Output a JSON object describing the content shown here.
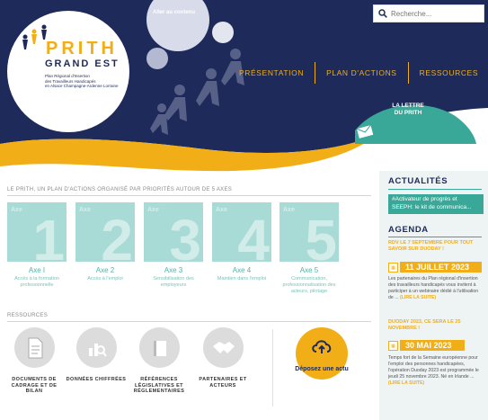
{
  "header": {
    "skip_link": "Aller au contenu",
    "search_placeholder": "Recherche...",
    "nav": [
      "PRÉSENTATION",
      "PLAN D'ACTIONS",
      "RESSOURCES"
    ],
    "lettre_line1": "LA LETTRE",
    "lettre_line2": "DU PRITH"
  },
  "logo": {
    "title": "PRITH",
    "subtitle": "GRAND EST",
    "tagline_1": "Plan Régional d'Insertion",
    "tagline_2": "des Travailleurs Handicapés",
    "tagline_3": "en Alsace Champagne-Ardenne Lorraine"
  },
  "plan": {
    "title": "LE PRITH, UN PLAN D'ACTIONS ORGANISÉ PAR PRIORITÉS AUTOUR DE 5 AXES",
    "axes": [
      {
        "tile": "Axe",
        "num": "1",
        "name": "Axe I",
        "desc": "Accès à la formation professionnelle"
      },
      {
        "tile": "Axe",
        "num": "2",
        "name": "Axe 2",
        "desc": "Accès à l'emploi"
      },
      {
        "tile": "Axe",
        "num": "3",
        "name": "Axe 3",
        "desc": "Sensibilisation des employeurs"
      },
      {
        "tile": "Axe",
        "num": "4",
        "name": "Axe 4",
        "desc": "Maintien dans l'emploi"
      },
      {
        "tile": "Axe",
        "num": "5",
        "name": "Axe 5",
        "desc": "Communication, professionnalisation des acteurs, pilotage"
      }
    ]
  },
  "resources": {
    "title": "RESSOURCES",
    "items": [
      {
        "icon": "document-icon",
        "label": "DOCUMENTS DE CADRAGE ET DE BILAN"
      },
      {
        "icon": "chart-search-icon",
        "label": "DONNÉES CHIFFRÉES"
      },
      {
        "icon": "book-icon",
        "label": "RÉFÉRENCES LÉGISLATIVES ET RÉGLEMENTAIRES"
      },
      {
        "icon": "handshake-icon",
        "label": "PARTENAIRES ET ACTEURS"
      }
    ],
    "deposez": "Déposez une actu"
  },
  "sidebar": {
    "actualites_title": "ACTUALITÉS",
    "actualites_item": "#Activateur de progrès et SEEPH: le kit de communica...",
    "agenda_title": "AGENDA",
    "events": [
      {
        "title": "RDV LE 7 SEPTEMBRE POUR TOUT SAVOIR SUR DUODAY !",
        "date": "11 JUILLET 2023",
        "desc": "Les partenaires du Plan régional d'insertion des travailleurs handicapés vous invitent à participer à un webinaire dédié à l'utilisation de ...",
        "more": "(LIRE LA SUITE)"
      },
      {
        "title": "DUODAY 2023, CE SERA LE 25 NOVEMBRE !",
        "date": "30 MAI 2023",
        "desc": "Temps fort de la Semaine européenne pour l'emploi des personnes handicapées, l'opération Duoday 2023 est programmée le jeudi 25 novembre 2023. Né en Irlande ...",
        "more": "(LIRE LA SUITE)"
      }
    ]
  },
  "colors": {
    "navy": "#1e2a5a",
    "gold": "#f1ae17",
    "teal": "#3aa898",
    "tile": "#a9dbd6"
  }
}
